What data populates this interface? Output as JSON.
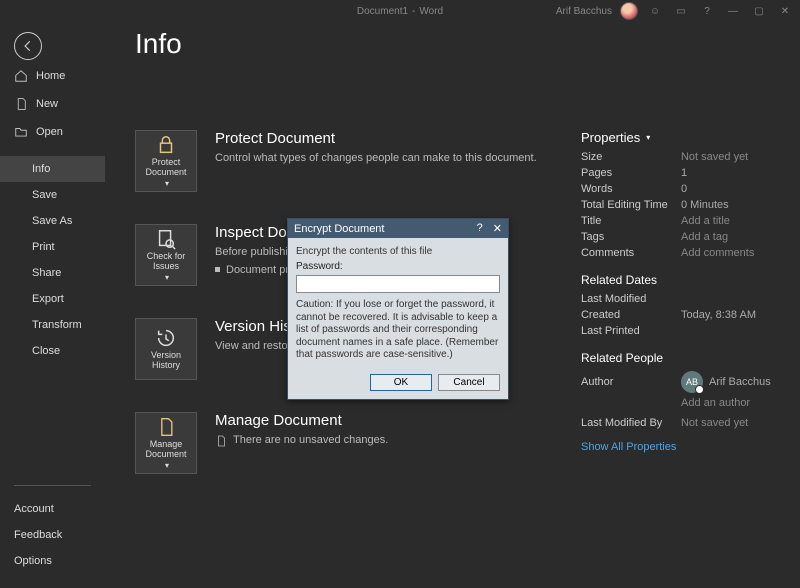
{
  "titlebar": {
    "doc_name": "Document1",
    "app_name": "Word",
    "user_name": "Arif Bacchus",
    "help": "?",
    "minimize": "—",
    "restore": "▢",
    "close": "✕"
  },
  "page": {
    "title": "Info"
  },
  "sidebar": {
    "home": "Home",
    "new": "New",
    "open": "Open",
    "info": "Info",
    "save": "Save",
    "saveas": "Save As",
    "print": "Print",
    "share": "Share",
    "export": "Export",
    "transform": "Transform",
    "close": "Close",
    "account": "Account",
    "feedback": "Feedback",
    "options": "Options"
  },
  "sections": {
    "protect": {
      "tile": "Protect Document",
      "title": "Protect Document",
      "text": "Control what types of changes people can make to this document."
    },
    "inspect": {
      "tile": "Check for Issues",
      "title": "Inspect Document",
      "lead": "Before publishing this file, be aware that it contains:",
      "bullet": "Document properties and author's name"
    },
    "version": {
      "tile": "Version History",
      "title": "Version History",
      "text": "View and restore previous versions."
    },
    "manage": {
      "tile": "Manage Document",
      "title": "Manage Document",
      "text": "There are no unsaved changes."
    }
  },
  "props": {
    "header": "Properties",
    "size_k": "Size",
    "size_v": "Not saved yet",
    "pages_k": "Pages",
    "pages_v": "1",
    "words_k": "Words",
    "words_v": "0",
    "time_k": "Total Editing Time",
    "time_v": "0 Minutes",
    "title_k": "Title",
    "title_v": "Add a title",
    "tags_k": "Tags",
    "tags_v": "Add a tag",
    "comments_k": "Comments",
    "comments_v": "Add comments",
    "dates_header": "Related Dates",
    "lastmod_k": "Last Modified",
    "lastmod_v": "",
    "created_k": "Created",
    "created_v": "Today, 8:38 AM",
    "lastprint_k": "Last Printed",
    "lastprint_v": "",
    "people_header": "Related People",
    "author_k": "Author",
    "author_initials": "AB",
    "author_name": "Arif Bacchus",
    "add_author": "Add an author",
    "lastby_k": "Last Modified By",
    "lastby_v": "Not saved yet",
    "show_all": "Show All Properties"
  },
  "dialog": {
    "title": "Encrypt Document",
    "heading": "Encrypt the contents of this file",
    "password_label": "Password:",
    "password_value": "",
    "caution": "Caution: If you lose or forget the password, it cannot be recovered. It is advisable to keep a list of passwords and their corresponding document names in a safe place. (Remember that passwords are case-sensitive.)",
    "ok": "OK",
    "cancel": "Cancel",
    "help": "?",
    "close": "✕"
  }
}
